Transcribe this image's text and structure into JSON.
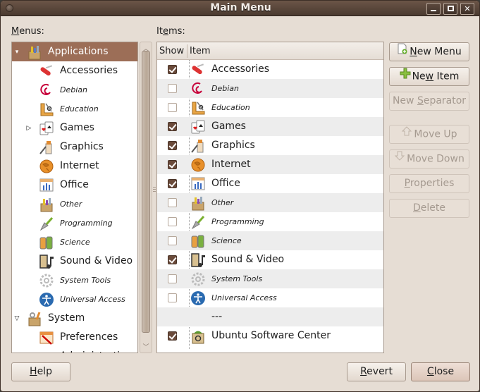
{
  "window": {
    "title": "Main Menu",
    "controls": {
      "minimize": "minimize",
      "maximize": "maximize",
      "close": "✕"
    }
  },
  "menus_label": {
    "accel": "M",
    "rest": "enus:"
  },
  "items_label": {
    "pre": "It",
    "accel": "e",
    "rest": "ms:"
  },
  "menus_tree": [
    {
      "label": "Applications",
      "level": 0,
      "expander": "▾",
      "icon": "applications-icon",
      "italic": false,
      "selected": true
    },
    {
      "label": "Accessories",
      "level": 1,
      "expander": "",
      "icon": "accessories-icon",
      "italic": false
    },
    {
      "label": "Debian",
      "level": 1,
      "expander": "",
      "icon": "debian-icon",
      "italic": true
    },
    {
      "label": "Education",
      "level": 1,
      "expander": "",
      "icon": "education-icon",
      "italic": true
    },
    {
      "label": "Games",
      "level": 1,
      "expander": "▷",
      "icon": "games-icon",
      "italic": false
    },
    {
      "label": "Graphics",
      "level": 1,
      "expander": "",
      "icon": "graphics-icon",
      "italic": false
    },
    {
      "label": "Internet",
      "level": 1,
      "expander": "",
      "icon": "internet-icon",
      "italic": false
    },
    {
      "label": "Office",
      "level": 1,
      "expander": "",
      "icon": "office-icon",
      "italic": false
    },
    {
      "label": "Other",
      "level": 1,
      "expander": "",
      "icon": "other-icon",
      "italic": true
    },
    {
      "label": "Programming",
      "level": 1,
      "expander": "",
      "icon": "programming-icon",
      "italic": true
    },
    {
      "label": "Science",
      "level": 1,
      "expander": "",
      "icon": "science-icon",
      "italic": true
    },
    {
      "label": "Sound & Video",
      "level": 1,
      "expander": "",
      "icon": "sound-video-icon",
      "italic": false
    },
    {
      "label": "System Tools",
      "level": 1,
      "expander": "",
      "icon": "system-tools-icon",
      "italic": true
    },
    {
      "label": "Universal Access",
      "level": 1,
      "expander": "",
      "icon": "universal-access-icon",
      "italic": true
    },
    {
      "label": "System",
      "level": 0,
      "expander": "▽",
      "icon": "system-icon",
      "italic": false
    },
    {
      "label": "Preferences",
      "level": 1,
      "expander": "",
      "icon": "preferences-icon",
      "italic": false
    },
    {
      "label": "Administration",
      "level": 1,
      "expander": "",
      "icon": "administration-icon",
      "italic": false
    }
  ],
  "items_table": {
    "columns": [
      "Show",
      "Item"
    ],
    "rows": [
      {
        "show": true,
        "label": "Accessories",
        "icon": "accessories-icon",
        "italic": false
      },
      {
        "show": false,
        "label": "Debian",
        "icon": "debian-icon",
        "italic": true
      },
      {
        "show": false,
        "label": "Education",
        "icon": "education-icon",
        "italic": true
      },
      {
        "show": true,
        "label": "Games",
        "icon": "games-icon",
        "italic": false
      },
      {
        "show": true,
        "label": "Graphics",
        "icon": "graphics-icon",
        "italic": false
      },
      {
        "show": true,
        "label": "Internet",
        "icon": "internet-icon",
        "italic": false
      },
      {
        "show": true,
        "label": "Office",
        "icon": "office-icon",
        "italic": false
      },
      {
        "show": false,
        "label": "Other",
        "icon": "other-icon",
        "italic": true
      },
      {
        "show": false,
        "label": "Programming",
        "icon": "programming-icon",
        "italic": true
      },
      {
        "show": false,
        "label": "Science",
        "icon": "science-icon",
        "italic": true
      },
      {
        "show": true,
        "label": "Sound & Video",
        "icon": "sound-video-icon",
        "italic": false
      },
      {
        "show": false,
        "label": "System Tools",
        "icon": "system-tools-icon",
        "italic": true
      },
      {
        "show": false,
        "label": "Universal Access",
        "icon": "universal-access-icon",
        "italic": true
      },
      {
        "show": null,
        "label": "---",
        "icon": "",
        "italic": false
      },
      {
        "show": true,
        "label": "Ubuntu Software Center",
        "icon": "software-center-icon",
        "italic": false
      }
    ]
  },
  "side_buttons": [
    {
      "id": "new-menu",
      "pre": "",
      "accel": "N",
      "rest": "ew Menu",
      "icon": "new-menu-icon",
      "enabled": true
    },
    {
      "id": "new-item",
      "pre": "Ne",
      "accel": "w",
      "rest": " Item",
      "icon": "new-item-icon",
      "enabled": true
    },
    {
      "id": "new-separator",
      "pre": "New ",
      "accel": "S",
      "rest": "eparator",
      "icon": "",
      "enabled": false
    },
    {
      "id": "move-up",
      "pre": "Move Up",
      "accel": "",
      "rest": "",
      "icon": "arrow-up-icon",
      "enabled": false
    },
    {
      "id": "move-down",
      "pre": "Move Down",
      "accel": "",
      "rest": "",
      "icon": "arrow-down-icon",
      "enabled": false
    },
    {
      "id": "properties",
      "pre": "",
      "accel": "P",
      "rest": "roperties",
      "icon": "",
      "enabled": false
    },
    {
      "id": "delete",
      "pre": "",
      "accel": "D",
      "rest": "elete",
      "icon": "",
      "enabled": false
    }
  ],
  "footer": {
    "help": {
      "accel": "H",
      "rest": "elp"
    },
    "revert": {
      "accel": "R",
      "rest": "evert"
    },
    "close": {
      "accel": "C",
      "rest": "lose"
    }
  },
  "colors": {
    "selection": "#9c6e57",
    "titlebar": "#4a3a30",
    "checkbox_on": "#6a4a3a",
    "dialog_bg": "#e6ddd4"
  }
}
